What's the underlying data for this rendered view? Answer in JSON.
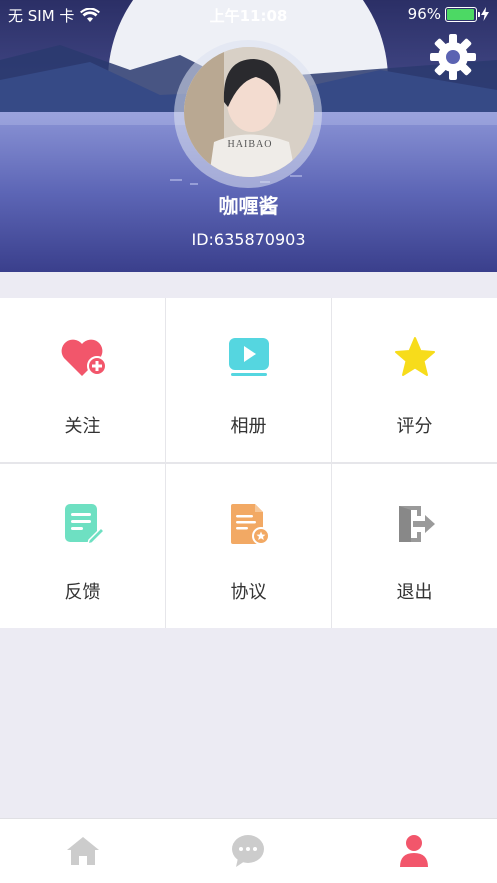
{
  "status_bar": {
    "carrier": "无 SIM 卡",
    "time": "上午11:08",
    "battery_percent": "96%",
    "battery_level": 0.96
  },
  "profile": {
    "nickname": "咖喱酱",
    "user_id": "ID:635870903",
    "avatar_shirt_text": "HAIBAO"
  },
  "menu": {
    "items": [
      {
        "label": "关注",
        "icon": "heart-plus-icon",
        "color": "#f2566b"
      },
      {
        "label": "相册",
        "icon": "video-album-icon",
        "color": "#55d6e0"
      },
      {
        "label": "评分",
        "icon": "star-icon",
        "color": "#f7dc1b"
      },
      {
        "label": "反馈",
        "icon": "edit-note-icon",
        "color": "#6ee0c2"
      },
      {
        "label": "协议",
        "icon": "agreement-doc-icon",
        "color": "#f2a964"
      },
      {
        "label": "退出",
        "icon": "logout-icon",
        "color": "#999999"
      }
    ]
  },
  "tabbar": {
    "tabs": [
      {
        "name": "home",
        "icon": "home-icon",
        "active": false
      },
      {
        "name": "messages",
        "icon": "chat-bubble-icon",
        "active": false
      },
      {
        "name": "profile",
        "icon": "user-icon",
        "active": true
      }
    ],
    "active_color": "#f2566b",
    "inactive_color": "#cccccc"
  }
}
